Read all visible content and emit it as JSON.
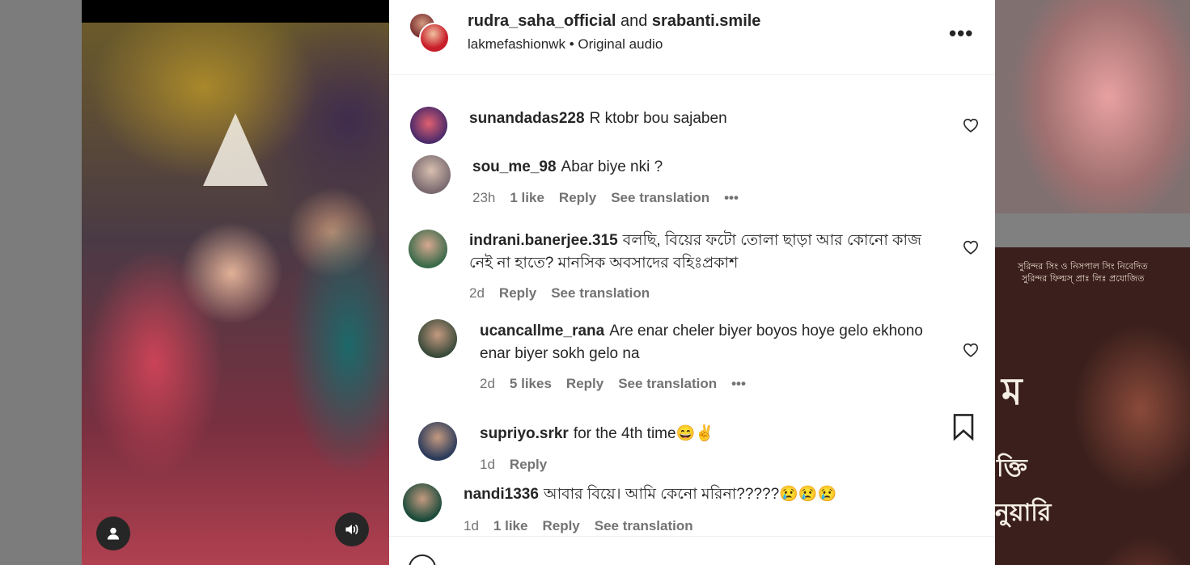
{
  "post": {
    "author1": "rudra_saha_official",
    "connector": "and",
    "author2": "srabanti.smile",
    "sub_account": "lakmefashionwk",
    "separator": "•",
    "audio": "Original audio",
    "more_icon": "more-horizontal-icon"
  },
  "comments": [
    {
      "user": "sunandadas228",
      "text": "R ktobr bou sajaben"
    },
    {
      "user": "sou_me_98",
      "text": "Abar biye nki ?",
      "time": "23h",
      "likes": "1 like",
      "reply": "Reply",
      "translate": "See translation",
      "more": "•••"
    },
    {
      "user": "indrani.banerjee.315",
      "text": "বলছি, বিয়ের ফটো তোলা ছাড়া আর কোনো কাজ নেই না হাতে? মানসিক অবসাদের বহিঃপ্রকাশ",
      "time": "2d",
      "reply": "Reply",
      "translate": "See translation"
    },
    {
      "user": "ucancallme_rana",
      "text": "Are enar cheler biyer boyos hoye gelo ekhono enar biyer sokh gelo na",
      "time": "2d",
      "likes": "5 likes",
      "reply": "Reply",
      "translate": "See translation",
      "more": "•••"
    },
    {
      "user": "supriyo.srkr",
      "text": "for the 4th time😄✌",
      "time": "1d",
      "reply": "Reply"
    },
    {
      "user": "nandi1336",
      "text": "আবার বিয়ে। আমি কেনো মরিনা?????😢😢😢",
      "time": "1d",
      "likes": "1 like",
      "reply": "Reply",
      "translate": "See translation"
    }
  ],
  "poster": {
    "line1": "সুরিন্দর সিং ও নিসপাল সিং নিবেদিত",
    "line2": "সুরিন্দর ফিল্মস্ প্রাঃ লিঃ প্রযোজিত",
    "title_fragment": "ম",
    "word1": "ক্তি",
    "word2": "নুয়ারি"
  },
  "colors": {
    "text": "#262626",
    "muted": "#737373",
    "panel": "#ffffff",
    "backdrop": "#7a7a7a"
  }
}
